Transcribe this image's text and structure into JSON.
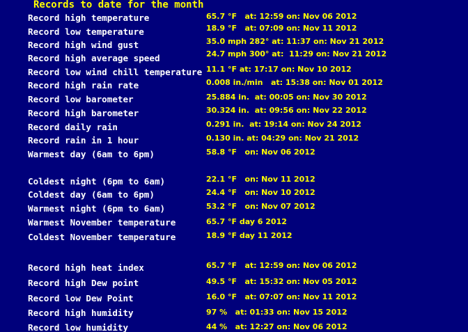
{
  "heading": "Records to date for the month",
  "records": [
    {
      "label": "Record high temperature",
      "value": "65.7 °F   at: 12:59 on: Nov 06 2012"
    },
    {
      "label": "Record low temperature",
      "value": "18.9 °F   at: 07:09 on: Nov 11 2012"
    },
    {
      "label": "Record high wind gust",
      "value": "35.0 mph 282° at: 11:37 on: Nov 21 2012"
    },
    {
      "label": "Record high average speed",
      "value": "24.7 mph 300° at:  11:29 on: Nov 21 2012"
    },
    {
      "label": "Record low wind chill temperature",
      "value": "11.1 °F at: 17:17 on: Nov 10 2012"
    },
    {
      "label": "Record high rain rate",
      "value": "0.008 in./min   at: 15:38 on: Nov 01 2012"
    },
    {
      "label": "Record low barometer",
      "value": "25.884 in.  at: 00:05 on: Nov 30 2012"
    },
    {
      "label": "Record high barometer",
      "value": "30.324 in.  at: 09:56 on: Nov 22 2012"
    },
    {
      "label": "Record daily rain",
      "value": "0.291 in.  at: 19:14 on: Nov 24 2012"
    },
    {
      "label": "Record rain in 1 hour",
      "value": "0.130 in. at: 04:29 on: Nov 21 2012"
    },
    {
      "label": "Warmest day (6am to 6pm)",
      "value": "58.8 °F   on: Nov 06 2012"
    },
    {
      "label": "Coldest night (6pm to 6am)",
      "value": "22.1 °F   on: Nov 11 2012"
    },
    {
      "label": "Coldest day (6am to 6pm)",
      "value": "24.4 °F   on: Nov 10 2012"
    },
    {
      "label": "Warmest night (6pm to 6am)",
      "value": "53.2 °F   on: Nov 07 2012"
    },
    {
      "label": "Warmest November temperature",
      "value": "65.7 °F day 6 2012"
    },
    {
      "label": "Coldest November temperature",
      "value": "18.9 °F day 11 2012"
    },
    {
      "label": "Record high heat index",
      "value": "65.7 °F   at: 12:59 on: Nov 06 2012"
    },
    {
      "label": "Record high Dew point",
      "value": "49.5 °F   at: 15:32 on: Nov 05 2012"
    },
    {
      "label": "Record low Dew Point",
      "value": "16.0 °F   at: 07:07 on: Nov 11 2012"
    },
    {
      "label": "Record high humidity",
      "value": "97 %   at: 01:33 on: Nov 15 2012"
    },
    {
      "label": "Record low humidity",
      "value": "44 %   at: 12:27 on: Nov 06 2012"
    }
  ]
}
